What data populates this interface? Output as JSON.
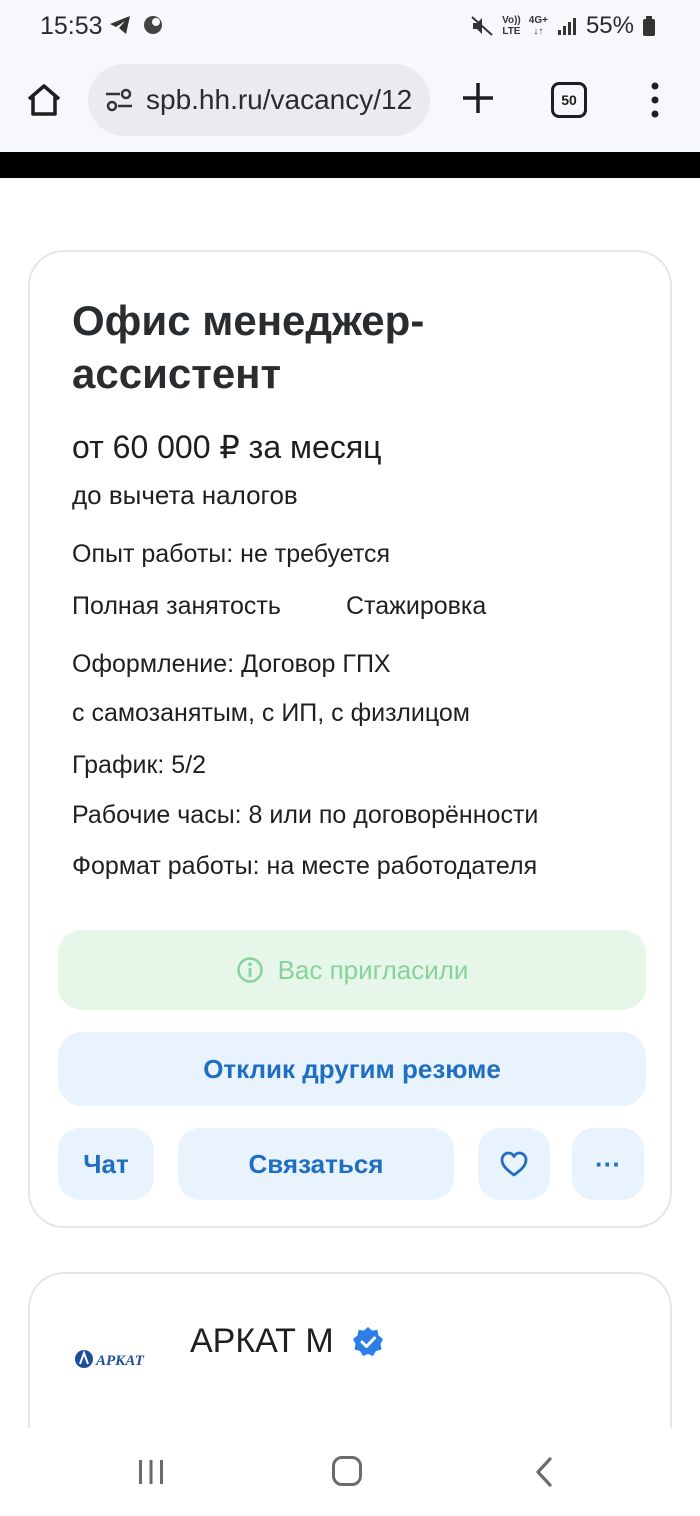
{
  "status_bar": {
    "time": "15:53",
    "battery": "55%",
    "network_top": "Vo))",
    "network_bottom": "LTE",
    "data_type": "4G+"
  },
  "browser": {
    "url": "spb.hh.ru/vacancy/12",
    "tab_count": "50"
  },
  "vacancy": {
    "title": "Офис менеджер-ассистент",
    "salary": "от 60 000 ₽ за месяц",
    "salary_note": "до вычета налогов",
    "experience": "Опыт работы: не требуется",
    "employment_full": "Полная занятость",
    "employment_intern": "Стажировка",
    "contract": "Оформление: Договор ГПХ",
    "contract_details": "с самозанятым, с ИП, с физлицом",
    "schedule": "График: 5/2",
    "hours": "Рабочие часы: 8 или по договорённости",
    "work_format": "Формат работы: на месте работодателя"
  },
  "actions": {
    "invited": "Вас пригласили",
    "respond_other": "Отклик другим резюме",
    "chat": "Чат",
    "contact": "Связаться",
    "more": "···"
  },
  "company": {
    "name": "АРКАТ М",
    "logo_text": "АРКАТ"
  },
  "colors": {
    "accent": "#1f6ec1",
    "invited_bg": "#e6f7ea",
    "invited_text": "#86d39c",
    "button_bg": "#e8f3fd",
    "verified": "#2d7ee6"
  }
}
